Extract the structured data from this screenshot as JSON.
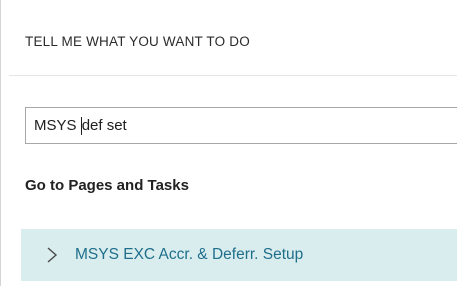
{
  "panel": {
    "header": "TELL ME WHAT YOU WANT TO DO"
  },
  "search": {
    "value_before_caret": "MSYS ",
    "value_after_caret": "def set"
  },
  "section": {
    "title": "Go to Pages and Tasks"
  },
  "results": [
    {
      "label": "MSYS EXC Accr. & Deferr. Setup",
      "icon": "chevron-right-icon"
    }
  ],
  "colors": {
    "result_highlight": "#d9ecee",
    "result_text": "#1f6f8b",
    "search_border": "#a8a8a8"
  }
}
